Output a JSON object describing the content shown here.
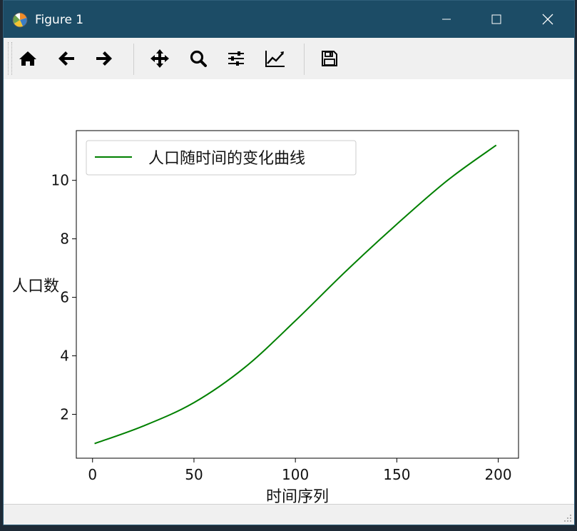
{
  "window": {
    "title": "Figure 1",
    "controls": [
      "minimize",
      "maximize",
      "close"
    ]
  },
  "toolbar": {
    "buttons": [
      {
        "name": "home",
        "icon": "home-icon"
      },
      {
        "name": "back",
        "icon": "arrow-left-icon"
      },
      {
        "name": "forward",
        "icon": "arrow-right-icon"
      },
      {
        "name": "pan",
        "icon": "move-icon"
      },
      {
        "name": "zoom",
        "icon": "magnifier-icon"
      },
      {
        "name": "configure-subplots",
        "icon": "sliders-icon"
      },
      {
        "name": "edit-axis",
        "icon": "line-chart-icon"
      },
      {
        "name": "save",
        "icon": "floppy-disk-icon"
      }
    ]
  },
  "colors": {
    "titlebar": "#1c4c66",
    "series_line": "#008000"
  },
  "chart_data": {
    "type": "line",
    "title": "",
    "xlabel": "时间序列",
    "ylabel": "人口数",
    "xlim": [
      -8,
      210
    ],
    "ylim": [
      0.5,
      11.7
    ],
    "xticks": [
      0,
      50,
      100,
      150,
      200
    ],
    "yticks": [
      2,
      4,
      6,
      8,
      10
    ],
    "legend_position": "top-left",
    "series": [
      {
        "name": "人口随时间的变化曲线",
        "color": "#008000",
        "x": [
          1,
          25,
          50,
          75,
          100,
          125,
          150,
          175,
          199
        ],
        "y": [
          1.0,
          1.6,
          2.4,
          3.6,
          5.2,
          6.9,
          8.5,
          10.0,
          11.2
        ]
      }
    ]
  }
}
